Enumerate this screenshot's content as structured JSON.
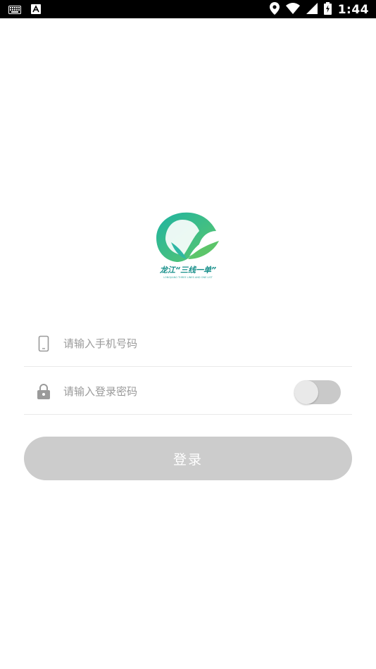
{
  "status_bar": {
    "time": "1:44",
    "icons": [
      "keyboard-icon",
      "text-a-icon",
      "location-icon",
      "wifi-icon",
      "signal-icon",
      "battery-charging-icon"
    ]
  },
  "logo": {
    "text": "龙江“三线一单”",
    "subtext": "LONGJIANG THREE LINES AND ONE LIST",
    "colors": {
      "teal": "#1aa89a",
      "green": "#5cc56a",
      "text": "#178f8a"
    }
  },
  "form": {
    "phone": {
      "placeholder": "请输入手机号码",
      "value": "",
      "icon": "phone-icon"
    },
    "password": {
      "placeholder": "请输入登录密码",
      "value": "",
      "icon": "lock-icon",
      "show_password_toggle": "off"
    }
  },
  "login_button": {
    "label": "登录",
    "color": "#cccccc"
  }
}
